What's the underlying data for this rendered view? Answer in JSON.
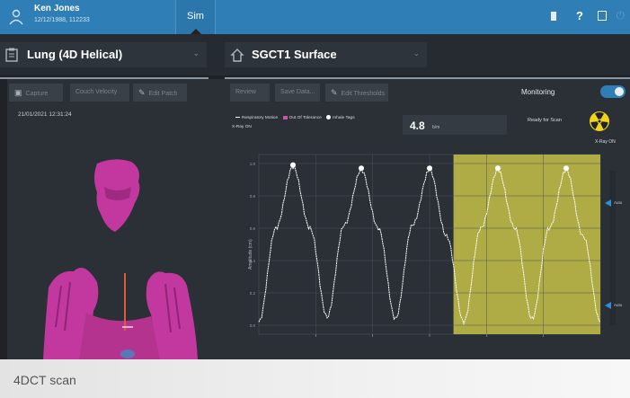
{
  "topbar": {
    "user_name": "Ken Jones",
    "user_info": "12/12/1988, 112233",
    "active_tab": "Sim",
    "icons": [
      "user-icon",
      "battery-icon",
      "help-icon",
      "save-icon",
      "power-icon"
    ],
    "help_glyph": "?"
  },
  "mode_selectors": {
    "protocol": "Lung (4D Helical)",
    "surface": "SGCT1 Surface"
  },
  "left_panel": {
    "buttons": [
      "Capture",
      "Couch Velocity",
      "Edit Patch"
    ],
    "timestamp": "21/01/2021 12:31:24"
  },
  "right_panel": {
    "buttons": [
      "Review",
      "Save Data...",
      "Edit Thresholds"
    ],
    "monitoring_label": "Monitoring",
    "monitoring_on": true,
    "legend": [
      "Respiratory Motion",
      "Out Of Tolerance",
      "Inhale Tags"
    ],
    "legend_row2": "X-Ray ON",
    "amplitude_value": "4.8",
    "amplitude_unit": "b/m",
    "status": "Ready for Scan",
    "xray_status": "X-Ray ON",
    "markers": [
      "Auto",
      "Auto"
    ],
    "y_axis_label": "Amplitude (cm)"
  },
  "colors": {
    "accent": "#2f7fb6",
    "panel": "#2b3037",
    "xray_band": "#b0ac45",
    "out_of_tolerance": "#d04fb0",
    "model": "#c2389e"
  },
  "chart_data": {
    "type": "line",
    "title": "",
    "ylabel": "Amplitude (cm)",
    "ylim": [
      0.0,
      1.0
    ],
    "y_ticks": [
      "1.0",
      "0.8",
      "0.6",
      "0.4",
      "0.2",
      "0.0"
    ],
    "xray_on_start_fraction": 0.57,
    "series": [
      {
        "name": "Respiratory Motion",
        "values": [
          0.02,
          0.6,
          0.98,
          0.6,
          0.05,
          0.62,
          0.96,
          0.6,
          0.04,
          0.62,
          0.96,
          0.55,
          0.02,
          0.6,
          0.96,
          0.6,
          0.04,
          0.6,
          0.96,
          0.55,
          0.02
        ]
      }
    ],
    "inhale_tags": [
      2,
      6,
      10,
      14,
      18
    ]
  },
  "caption": "4DCT scan"
}
